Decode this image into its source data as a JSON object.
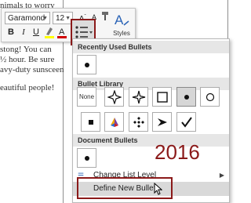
{
  "document": {
    "lines": [
      "nimals to worry",
      "stong! You can",
      "½ hour. Be sure",
      "avy-duty sunsceen",
      "eautiful people!"
    ]
  },
  "mini_toolbar": {
    "font_name": "Garamond",
    "font_size": "12",
    "bold_label": "B",
    "italic_label": "I",
    "underline_label": "U",
    "styles_label": "Styles"
  },
  "bullet_menu": {
    "recent_header": "Recently Used Bullets",
    "library_header": "Bullet Library",
    "library_none_label": "None",
    "document_header": "Document Bullets",
    "change_level_label": "Change List Level",
    "define_new_label": "Define New Bullet...",
    "library_symbols": [
      "none",
      "four-point-star",
      "four-point-star-alt",
      "hollow-square",
      "filled-circle",
      "hollow-circle",
      "filled-square",
      "colorful-cube",
      "diamond-cluster",
      "arrowhead",
      "checkmark"
    ],
    "selected_symbol": "filled-circle"
  },
  "annotation": {
    "year": "2016",
    "highlight_color": "#8b1a1a"
  }
}
